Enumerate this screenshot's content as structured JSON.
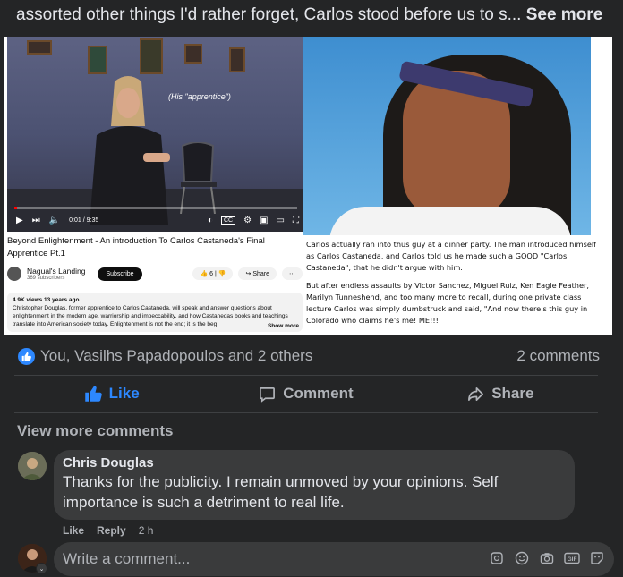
{
  "post": {
    "text": "assorted other things I'd rather forget, Carlos stood before us to s...",
    "see_more": "See more"
  },
  "video": {
    "overlay_caption": "(His \"apprentice\")",
    "time": "0:01 / 9:35",
    "title": "Beyond Enlightenment - An introduction To Carlos Castaneda's Final Apprentice Pt.1",
    "channel": "Nagual's Landing",
    "subscribers": "369 subscribers",
    "subscribe_label": "Subscribe",
    "likes": "6",
    "share_label": "Share",
    "stats": "4.9K views  13 years ago",
    "description": "Christopher Douglas, former apprentice to Carlos Castaneda, will speak and answer questions about enlightenment in the modern age, warriorship and impeccability, and how Castanedas books and teachings translate into American society today. Enlightenment is not the end; it is the beg",
    "show_more": "Show more",
    "progress": 0.01
  },
  "photo_caption": {
    "para1": "Carlos actually ran into thus guy at a dinner party. The man introduced himself as Carlos Castaneda, and Carlos told us he made such a GOOD \"Carlos Castaneda\", that he didn't argue with him.",
    "para2": "But after endless assaults by Victor Sanchez, Miguel Ruiz, Ken Eagle Feather, Marilyn Tunneshend, and too many more to recall, during one private class lecture Carlos was simply dumbstruck and said, \"And now there's this guy in Colorado who claims he's me! ME!!!"
  },
  "reactions": {
    "names": "You, Vasilhs Papadopoulos and 2 others",
    "comments_count": "2 comments"
  },
  "actions": {
    "like": "Like",
    "comment": "Comment",
    "share": "Share"
  },
  "view_more_comments": "View more comments",
  "comment": {
    "author": "Chris Douglas",
    "text": "Thanks for the publicity. I remain unmoved by your opinions. Self importance is such a detriment to real life.",
    "like": "Like",
    "reply": "Reply",
    "time": "2 h"
  },
  "composer": {
    "placeholder": "Write a comment..."
  },
  "colors": {
    "accent": "#2d88ff",
    "background": "#242526",
    "bubble": "#3a3b3c"
  }
}
